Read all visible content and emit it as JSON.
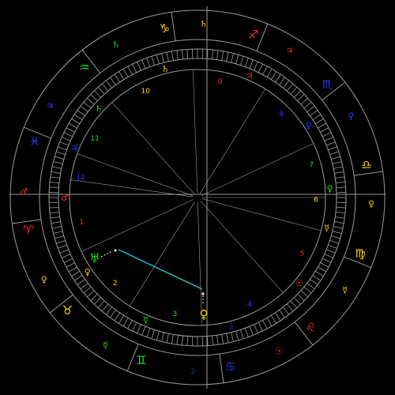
{
  "colors": {
    "background": "#000000",
    "lines": "#9a9a9a",
    "fire": "#ff2a2a",
    "earth": "#ffd700",
    "air": "#20e020",
    "water": "#2a3cff",
    "aspect": "#20c0c0"
  },
  "zodiac_ring": [
    {
      "sign": "capricorn",
      "glyph": "♑",
      "element": "earth",
      "ruler": "♄",
      "ruler_element": "earth"
    },
    {
      "sign": "sagittarius",
      "glyph": "♐",
      "element": "fire",
      "ruler": "♃",
      "ruler_element": "fire"
    },
    {
      "sign": "scorpio",
      "glyph": "♏",
      "element": "water",
      "ruler": "♀",
      "ruler_element": "water"
    },
    {
      "sign": "libra",
      "glyph": "♎",
      "element": "earth",
      "ruler": "♀",
      "ruler_element": "earth"
    },
    {
      "sign": "virgo",
      "glyph": "♍",
      "element": "earth",
      "ruler": "☿",
      "ruler_element": "earth"
    },
    {
      "sign": "leo",
      "glyph": "♌",
      "element": "fire",
      "ruler": "☉",
      "ruler_element": "fire"
    },
    {
      "sign": "cancer",
      "glyph": "♋",
      "element": "water",
      "ruler": "☽",
      "ruler_element": "water"
    },
    {
      "sign": "gemini",
      "glyph": "♊",
      "element": "air",
      "ruler": "☿",
      "ruler_element": "air"
    },
    {
      "sign": "taurus",
      "glyph": "♉",
      "element": "earth",
      "ruler": "♀",
      "ruler_element": "earth"
    },
    {
      "sign": "aries",
      "glyph": "♈",
      "element": "fire",
      "ruler": "♂",
      "ruler_element": "fire"
    },
    {
      "sign": "pisces",
      "glyph": "♓",
      "element": "water",
      "ruler": "♃",
      "ruler_element": "water"
    },
    {
      "sign": "aquarius",
      "glyph": "♒",
      "element": "air",
      "ruler": "♄",
      "ruler_element": "air"
    }
  ],
  "houses": [
    {
      "number": "1",
      "ruler": "♂",
      "element": "fire"
    },
    {
      "number": "2",
      "ruler": "♀",
      "element": "earth"
    },
    {
      "number": "3",
      "ruler": "☿",
      "element": "air"
    },
    {
      "number": "4",
      "ruler": "☽",
      "element": "water"
    },
    {
      "number": "5",
      "ruler": "☉",
      "element": "fire"
    },
    {
      "number": "6",
      "ruler": "☿",
      "element": "earth"
    },
    {
      "number": "7",
      "ruler": "♀",
      "element": "air"
    },
    {
      "number": "8",
      "ruler": "♀",
      "element": "water"
    },
    {
      "number": "9",
      "ruler": "♃",
      "element": "fire"
    },
    {
      "number": "10",
      "ruler": "♄",
      "element": "earth"
    },
    {
      "number": "11",
      "ruler": "♄",
      "element": "air"
    },
    {
      "number": "12",
      "ruler": "♃",
      "element": "water"
    }
  ],
  "planets": [
    {
      "name": "uranus",
      "glyph": "♅",
      "element": "air"
    },
    {
      "name": "venus",
      "glyph": "♀",
      "element": "earth"
    }
  ]
}
